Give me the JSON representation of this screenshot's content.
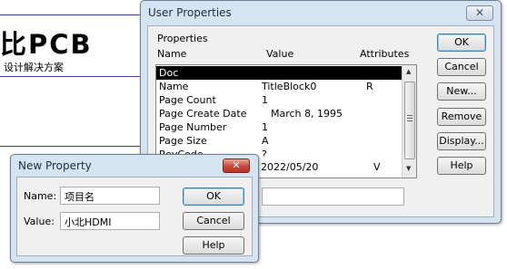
{
  "background": {
    "logo_text": "比PCB",
    "logo_subtext": "设计解决方案"
  },
  "user_properties": {
    "title": "User Properties",
    "group_label": "Properties",
    "columns": [
      "Name",
      "Value",
      "Attributes"
    ],
    "rows": [
      {
        "name": "Doc",
        "value": "",
        "attr": "",
        "selected": true
      },
      {
        "name": "Name",
        "value": "TitleBlock0",
        "attr": "R"
      },
      {
        "name": "Page Count",
        "value": "1",
        "attr": ""
      },
      {
        "name": "Page Create Date",
        "value": "March  8, 1995",
        "attr": ""
      },
      {
        "name": "Page Number",
        "value": "1",
        "attr": ""
      },
      {
        "name": "Page Size",
        "value": "A",
        "attr": ""
      },
      {
        "name": "RevCode",
        "value": "?",
        "attr": ""
      },
      {
        "name": "",
        "value": "2022/05/20",
        "attr": "V"
      }
    ],
    "buttons": {
      "ok": "OK",
      "cancel": "Cancel",
      "new": "New...",
      "remove": "Remove",
      "display": "Display...",
      "help": "Help"
    }
  },
  "new_property": {
    "title": "New Property",
    "name_label": "Name:",
    "name_value": "项目名",
    "value_label": "Value:",
    "value_value": "小北HDMI",
    "buttons": {
      "ok": "OK",
      "cancel": "Cancel",
      "help": "Help"
    }
  }
}
